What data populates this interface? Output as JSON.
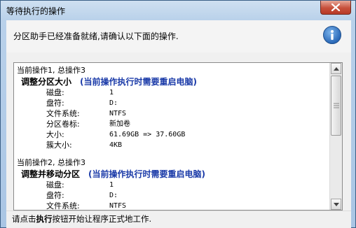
{
  "window": {
    "title": "等待执行的操作"
  },
  "header": {
    "message": "分区助手已经准备就绪,请确认以下面的操作."
  },
  "operations": [
    {
      "head": "当前操作1, 总操作3",
      "title": "调整分区大小",
      "note": "(当前操作执行时需要重启电脑)",
      "rows": [
        {
          "k": "磁盘:",
          "v": "1"
        },
        {
          "k": "盘符:",
          "v": "D:"
        },
        {
          "k": "文件系统:",
          "v": "NTFS"
        },
        {
          "k": "分区卷标:",
          "v": "新加卷"
        },
        {
          "k": "大小:",
          "v": "61.69GB => 37.60GB"
        },
        {
          "k": "簇大小:",
          "v": "4KB"
        }
      ]
    },
    {
      "head": "当前操作2, 总操作3",
      "title": "调整并移动分区",
      "note": "(当前操作执行时需要重启电脑)",
      "rows": [
        {
          "k": "磁盘:",
          "v": "1"
        },
        {
          "k": "盘符:",
          "v": "D:"
        },
        {
          "k": "文件系统:",
          "v": "NTFS"
        }
      ]
    }
  ],
  "footer": {
    "prefix": "请点击",
    "bold": "执行",
    "suffix": "按钮开始让程序正式地工作."
  },
  "icons": {
    "close": "close-icon",
    "info": "info-icon"
  }
}
